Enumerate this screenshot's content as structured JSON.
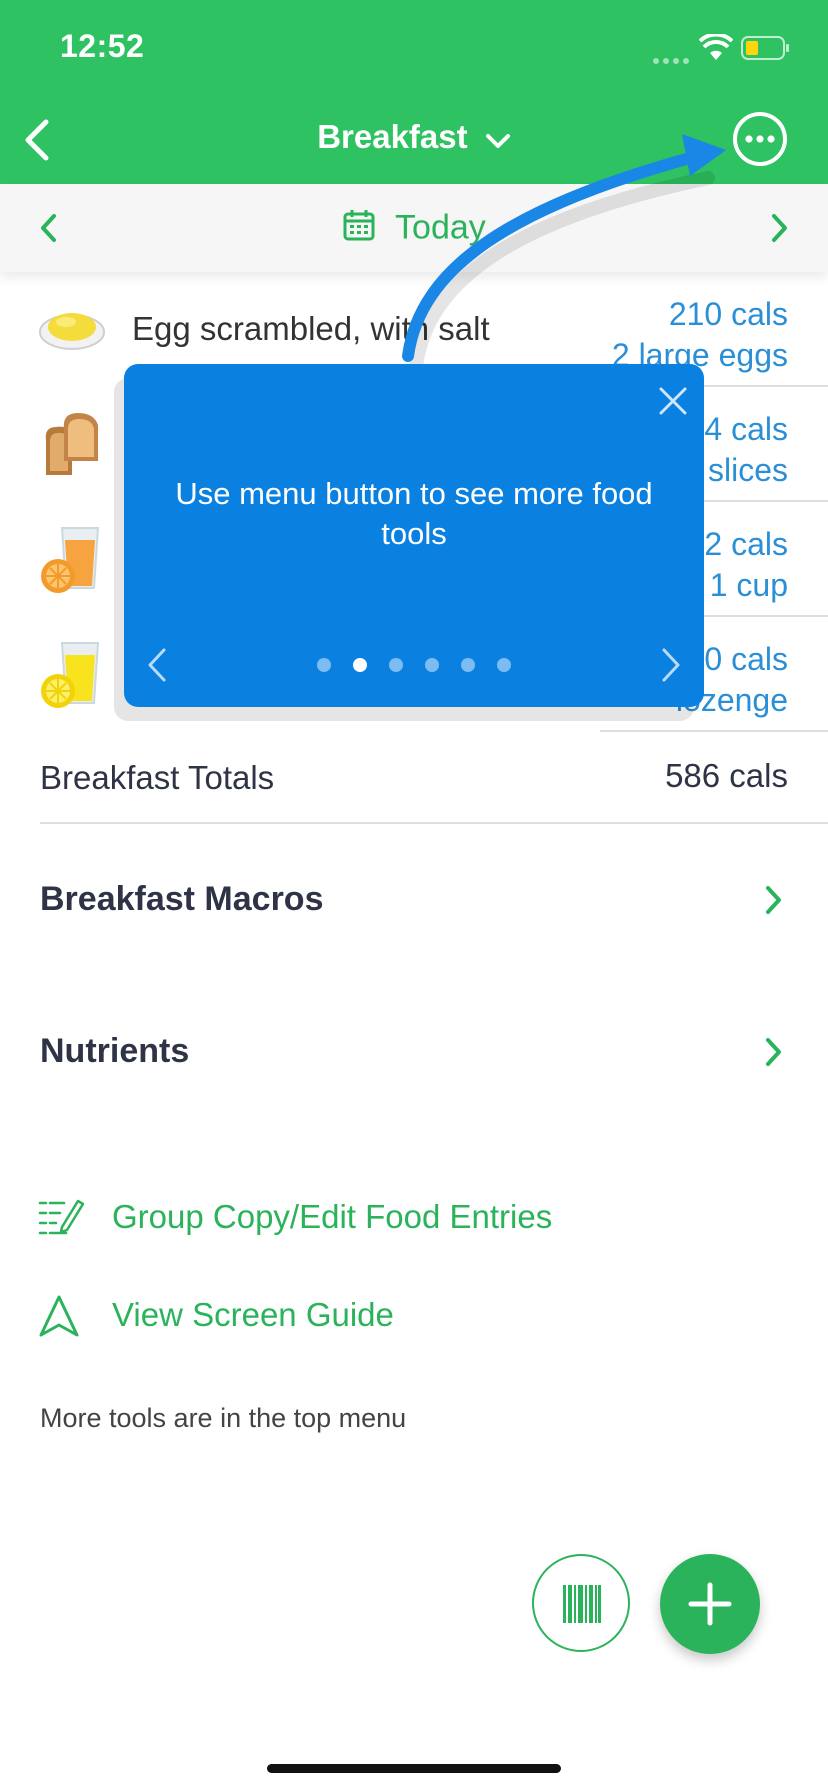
{
  "status_bar": {
    "time": "12:52"
  },
  "header": {
    "title": "Breakfast"
  },
  "date_nav": {
    "label": "Today"
  },
  "foods": [
    {
      "name": "Egg scrambled, with salt",
      "calories": "210 cals",
      "serving": "2 large eggs",
      "icon": "scrambled-egg-icon"
    },
    {
      "name": "",
      "calories": "4 cals",
      "serving": "slices",
      "icon": "toast-icon"
    },
    {
      "name": "",
      "calories": "2 cals",
      "serving": "1 cup",
      "icon": "orange-juice-icon"
    },
    {
      "name": "",
      "calories": "0 cals",
      "serving": "lozenge",
      "icon": "lemonade-icon"
    }
  ],
  "totals": {
    "label": "Breakfast Totals",
    "value": "586 cals"
  },
  "sections": {
    "macros": "Breakfast Macros",
    "nutrients": "Nutrients"
  },
  "tools": {
    "group_copy": "Group Copy/Edit Food Entries",
    "screen_guide": "View Screen Guide",
    "note": "More tools are in the top menu"
  },
  "tip": {
    "text": "Use menu button to see more food tools",
    "page_count": 6,
    "active_page": 2
  },
  "colors": {
    "brand_green": "#2ec262",
    "link_green": "#2ab35a",
    "tip_blue": "#0a80e0",
    "calorie_blue": "#2a8fd6"
  }
}
